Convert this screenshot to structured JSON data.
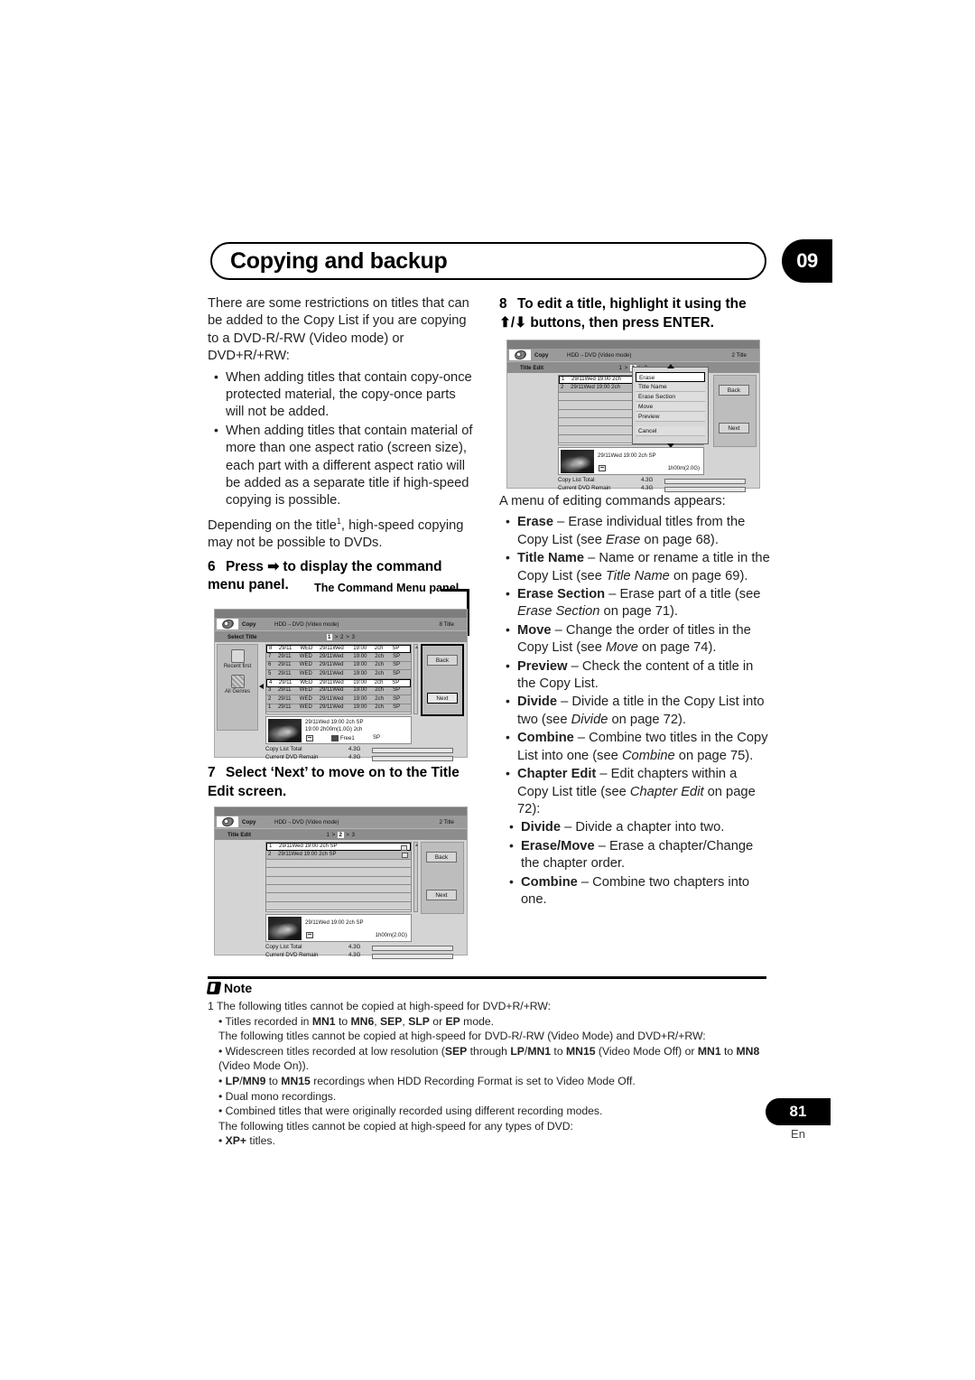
{
  "chapter": {
    "title": "Copying and backup",
    "number": "09"
  },
  "left_column": {
    "intro": "There are some restrictions on titles that can be added to the Copy List if you are copying to a DVD-R/-RW (Video mode) or DVD+R/+RW:",
    "bullets": [
      "When adding titles that contain copy-once protected material, the copy-once parts will not be added.",
      "When adding titles that contain material of more than one aspect ratio (screen size), each part with a different aspect ratio will be added as a separate title if high-speed copying is possible."
    ],
    "depending_pre": "Depending on the title",
    "depending_sup": "1",
    "depending_post": ", high-speed copying may not be possible to DVDs.",
    "step6": {
      "number": "6",
      "text_pre": "Press",
      "arrow": "➡",
      "text_post": "to display the command menu panel."
    },
    "callout": "The Command Menu panel",
    "step7": {
      "number": "7",
      "text": "Select ‘Next’ to move on to the Title Edit screen."
    }
  },
  "right_column": {
    "step8": {
      "number": "8",
      "line1": "To edit a title, highlight it using the",
      "arrows": "⬆/⬇",
      "line2": "buttons, then press ENTER."
    },
    "menu_intro": "A menu of editing commands appears:",
    "commands": [
      {
        "term": "Erase",
        "desc_pre": " – Erase individual titles from the Copy List (see ",
        "ref": "Erase",
        "desc_post": " on page 68)."
      },
      {
        "term": "Title Name",
        "desc_pre": " – Name or rename a title in the Copy List (see ",
        "ref": "Title Name",
        "desc_post": " on page 69)."
      },
      {
        "term": "Erase Section",
        "desc_pre": " – Erase part of a title (see ",
        "ref": "Erase Section",
        "desc_post": " on page 71)."
      },
      {
        "term": "Move",
        "desc_pre": " – Change the order of titles in the Copy List (see ",
        "ref": "Move",
        "desc_post": " on page 74)."
      },
      {
        "term": "Preview",
        "desc_pre": " – Check the content of a title in the Copy List.",
        "ref": "",
        "desc_post": ""
      },
      {
        "term": "Divide",
        "desc_pre": " – Divide a title in the Copy List into two (see ",
        "ref": "Divide",
        "desc_post": " on page 72)."
      },
      {
        "term": "Combine",
        "desc_pre": " – Combine two titles in the Copy List into one (see ",
        "ref": "Combine",
        "desc_post": " on page 75)."
      },
      {
        "term": "Chapter Edit",
        "desc_pre": " – Edit chapters within a Copy List title (see ",
        "ref": "Chapter Edit",
        "desc_post": " on page 72):"
      }
    ],
    "subcommands": [
      {
        "term": "Divide",
        "desc": " – Divide a chapter into two."
      },
      {
        "term": "Erase/Move",
        "desc": " – Erase a chapter/Change the chapter order."
      },
      {
        "term": "Combine",
        "desc": " – Combine two chapters into one."
      }
    ]
  },
  "screens": {
    "select_title": {
      "app": "Copy",
      "mode": "HDD→DVD (Video mode)",
      "count": "8  Title",
      "screen_label": "Select Title",
      "steps_pre": "1",
      "steps_post": "> 2 > 3",
      "tools": [
        {
          "label": "Recent first",
          "icon": "sort-icon"
        },
        {
          "label": "All Genres",
          "icon": "genres-icon"
        }
      ],
      "rows": [
        {
          "no": "8",
          "date": "29/11",
          "day": "WED",
          "date2": "29/11Wed",
          "time": "19:00",
          "audio": "2ch",
          "mode": "SP",
          "selected": false
        },
        {
          "no": "7",
          "date": "29/11",
          "day": "WED",
          "date2": "29/11Wed",
          "time": "19:00",
          "audio": "2ch",
          "mode": "SP",
          "selected": false
        },
        {
          "no": "6",
          "date": "29/11",
          "day": "WED",
          "date2": "29/11Wed",
          "time": "19:00",
          "audio": "2ch",
          "mode": "SP",
          "selected": false
        },
        {
          "no": "5",
          "date": "29/11",
          "day": "WED",
          "date2": "29/11Wed",
          "time": "19:00",
          "audio": "2ch",
          "mode": "SP",
          "selected": false
        },
        {
          "no": "4",
          "date": "29/11",
          "day": "WED",
          "date2": "29/11Wed",
          "time": "19:00",
          "audio": "2ch",
          "mode": "SP",
          "selected": true
        },
        {
          "no": "3",
          "date": "29/11",
          "day": "WED",
          "date2": "29/11Wed",
          "time": "19:00",
          "audio": "2ch",
          "mode": "SP",
          "selected": false
        },
        {
          "no": "2",
          "date": "29/11",
          "day": "WED",
          "date2": "29/11Wed",
          "time": "19:00",
          "audio": "2ch",
          "mode": "SP",
          "selected": false
        },
        {
          "no": "1",
          "date": "29/11",
          "day": "WED",
          "date2": "29/11Wed",
          "time": "19:00",
          "audio": "2ch",
          "mode": "SP",
          "selected": false
        }
      ],
      "buttons": {
        "back": "Back",
        "next": "Next"
      },
      "preview": {
        "line1": "29/11Wed  19:00   2ch    SP",
        "line2": "19:00      2h00m(1.0G)   2ch",
        "free": "Free1",
        "mode": "SP"
      },
      "totals": [
        {
          "label": "Copy List Total",
          "value": "4.3G"
        },
        {
          "label": "Current DVD Remain",
          "value": "4.3G"
        }
      ]
    },
    "title_edit": {
      "app": "Copy",
      "mode": "HDD→DVD (Video mode)",
      "count": "2  Title",
      "screen_label": "Title Edit",
      "steps_pre": "1 >",
      "steps_cur": "2",
      "steps_post": "> 3",
      "rows": [
        {
          "no": "1",
          "text": "29/11Wed  19:00   2ch    SP",
          "selected": true
        },
        {
          "no": "2",
          "text": "29/11Wed  19:00   2ch    SP",
          "selected": false
        }
      ],
      "buttons": {
        "back": "Back",
        "next": "Next"
      },
      "preview": {
        "line1": "29/11Wed  19:00   2ch    SP",
        "size": "1h00m(2.0G)"
      },
      "totals": [
        {
          "label": "Copy List Total",
          "value": "4.3G"
        },
        {
          "label": "Current DVD Remain",
          "value": "4.3G"
        }
      ]
    },
    "title_edit_menu": {
      "app": "Copy",
      "mode": "HDD→DVD (Video mode)",
      "count": "2  Title",
      "screen_label": "Title Edit",
      "steps_pre": "1 >",
      "steps_cur": "2",
      "steps_post": "> 3",
      "rows": [
        {
          "no": "1",
          "text": "29/11Wed  19:00   2ch",
          "selected": true
        },
        {
          "no": "2",
          "text": "29/11Wed  19:00   2ch",
          "selected": false
        }
      ],
      "menu_items": [
        "Erase",
        "Title Name",
        "Erase Section",
        "Move",
        "Preview"
      ],
      "menu_cancel": "Cancel",
      "buttons": {
        "back": "Back",
        "next": "Next"
      },
      "preview": {
        "line1": "29/11Wed  19:00   2ch    SP",
        "size": "1h00m(2.0G)"
      },
      "totals": [
        {
          "label": "Copy List Total",
          "value": "4.3G"
        },
        {
          "label": "Current DVD Remain",
          "value": "4.3G"
        }
      ]
    }
  },
  "note": {
    "title": "Note",
    "lines": [
      {
        "indent": false,
        "html": "1 The following titles cannot be copied at high-speed for DVD+R/+RW:"
      },
      {
        "indent": true,
        "html": "• Titles recorded in <b>MN1</b> to <b>MN6</b>, <b>SEP</b>, <b>SLP</b> or <b>EP</b> mode."
      },
      {
        "indent": true,
        "html": "The following titles cannot be copied at high-speed for DVD-R/-RW (Video Mode) and DVD+R/+RW:"
      },
      {
        "indent": true,
        "html": "• Widescreen titles recorded at low resolution (<b>SEP</b> through <b>LP</b>/<b>MN1</b> to <b>MN15</b> (Video Mode Off) or <b>MN1</b> to <b>MN8</b> (Video Mode On))."
      },
      {
        "indent": true,
        "html": "• <b>LP</b>/<b>MN9</b> to <b>MN15</b> recordings when HDD Recording Format is set to Video Mode Off."
      },
      {
        "indent": true,
        "html": "• Dual mono recordings."
      },
      {
        "indent": true,
        "html": "• Combined titles that were originally recorded using different recording modes."
      },
      {
        "indent": true,
        "html": "The following titles cannot be copied at high-speed for any types of DVD:"
      },
      {
        "indent": true,
        "html": "• <b>XP+</b> titles."
      }
    ]
  },
  "footer": {
    "page": "81",
    "lang": "En"
  }
}
